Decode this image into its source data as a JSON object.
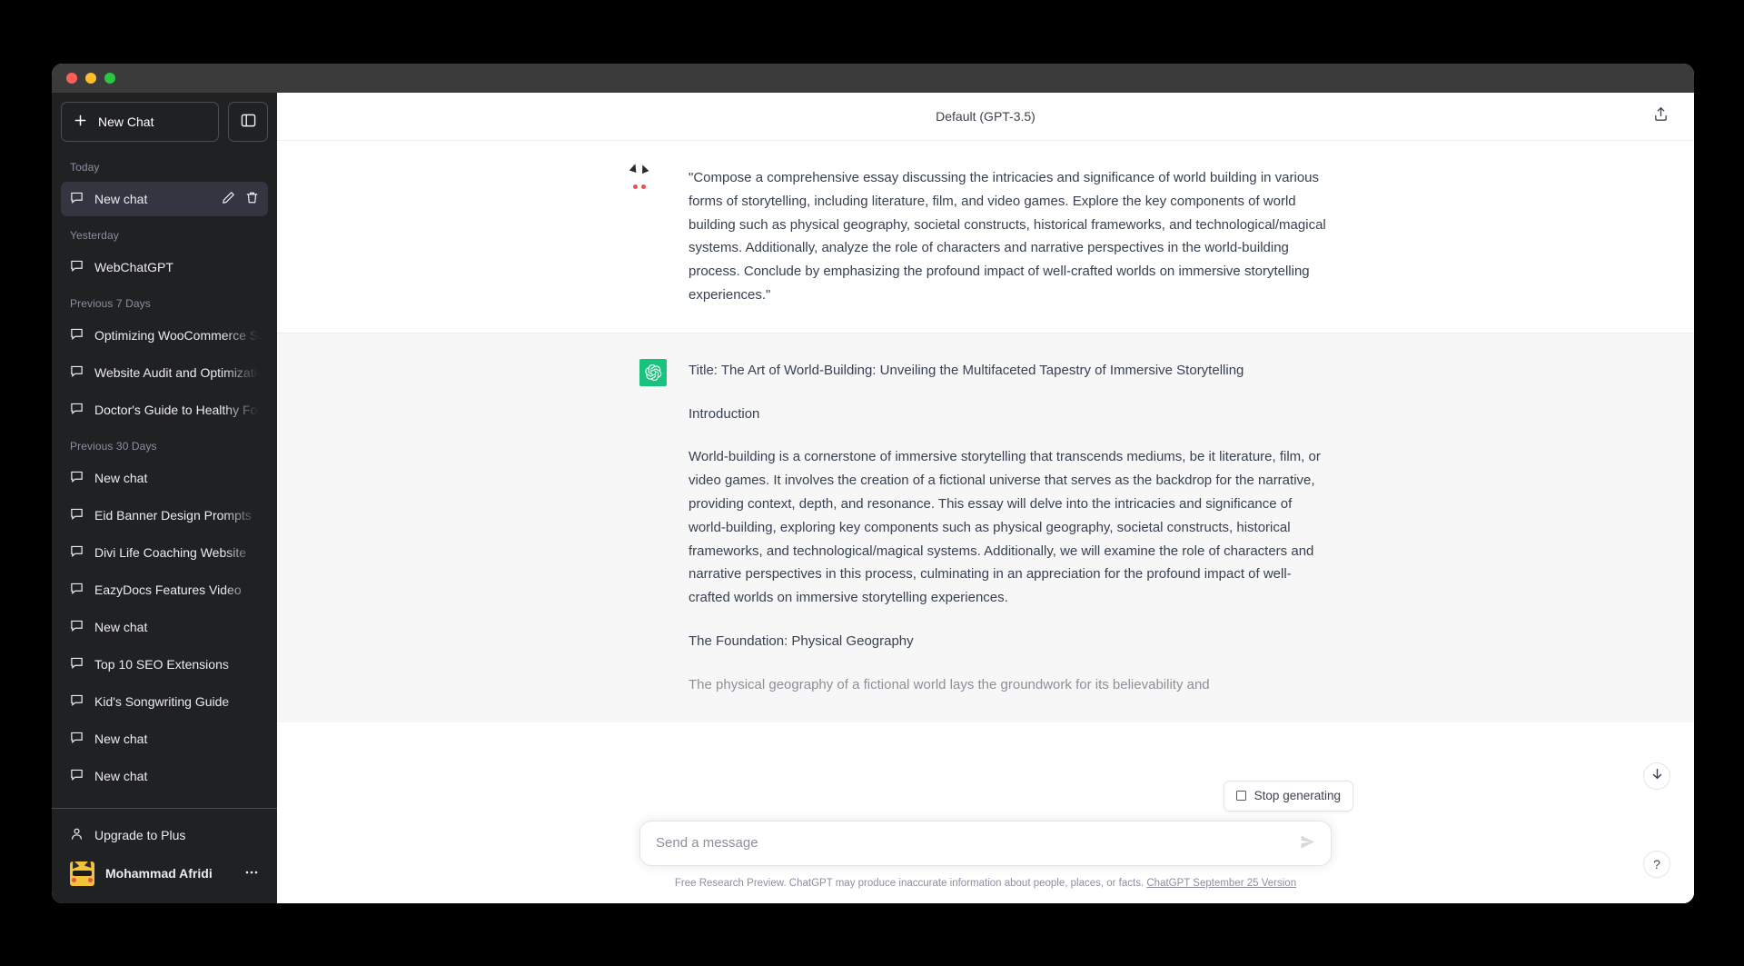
{
  "window": {
    "traffic_lights": [
      "close",
      "minimize",
      "zoom"
    ]
  },
  "sidebar": {
    "new_chat_label": "New Chat",
    "groups": [
      {
        "label": "Today",
        "items": [
          {
            "title": "New chat",
            "active": true
          }
        ]
      },
      {
        "label": "Yesterday",
        "items": [
          {
            "title": "WebChatGPT",
            "active": false
          }
        ]
      },
      {
        "label": "Previous 7 Days",
        "items": [
          {
            "title": "Optimizing WooCommerce SEO",
            "active": false
          },
          {
            "title": "Website Audit and Optimization",
            "active": false
          },
          {
            "title": "Doctor's Guide to Healthy Food",
            "active": false
          }
        ]
      },
      {
        "label": "Previous 30 Days",
        "items": [
          {
            "title": "New chat",
            "active": false
          },
          {
            "title": "Eid Banner Design Prompts",
            "active": false
          },
          {
            "title": "Divi Life Coaching Website",
            "active": false
          },
          {
            "title": "EazyDocs Features Video",
            "active": false
          },
          {
            "title": "New chat",
            "active": false
          },
          {
            "title": "Top 10 SEO Extensions",
            "active": false
          },
          {
            "title": "Kid's Songwriting Guide",
            "active": false
          },
          {
            "title": "New chat",
            "active": false
          },
          {
            "title": "New chat",
            "active": false
          }
        ]
      }
    ],
    "upgrade_label": "Upgrade to Plus",
    "user_name": "Mohammad Afridi"
  },
  "header": {
    "model": "Default (GPT-3.5)"
  },
  "conversation": {
    "user_message": {
      "paragraphs": [
        "\"Compose a comprehensive essay discussing the intricacies and significance of world building in various forms of storytelling, including literature, film, and video games. Explore the key components of world building such as physical geography, societal constructs, historical frameworks, and technological/magical systems. Additionally, analyze the role of characters and narrative perspectives in the world-building process. Conclude by emphasizing the profound impact of well-crafted worlds on immersive storytelling experiences.\""
      ]
    },
    "assistant_message": {
      "paragraphs": [
        "Title: The Art of World-Building: Unveiling the Multifaceted Tapestry of Immersive Storytelling",
        "Introduction",
        "World-building is a cornerstone of immersive storytelling that transcends mediums, be it literature, film, or video games. It involves the creation of a fictional universe that serves as the backdrop for the narrative, providing context, depth, and resonance. This essay will delve into the intricacies and significance of world-building, exploring key components such as physical geography, societal constructs, historical frameworks, and technological/magical systems. Additionally, we will examine the role of characters and narrative perspectives in this process, culminating in an appreciation for the profound impact of well-crafted worlds on immersive storytelling experiences.",
        "The Foundation: Physical Geography"
      ],
      "streaming_paragraph": "The physical geography of a fictional world lays the groundwork for its believability and"
    }
  },
  "composer": {
    "stop_generating_label": "Stop generating",
    "placeholder": "Send a message",
    "value": "",
    "disclaimer_text": "Free Research Preview. ChatGPT may produce inaccurate information about people, places, or facts.",
    "version_link": "ChatGPT September 25 Version"
  },
  "floating": {
    "help_label": "?"
  },
  "colors": {
    "sidebar_bg": "#202123",
    "active_chat_bg": "#343541",
    "assistant_bg": "#f7f7f8",
    "gpt_green": "#19c37d",
    "titlebar_bg": "#3b3b3b"
  }
}
